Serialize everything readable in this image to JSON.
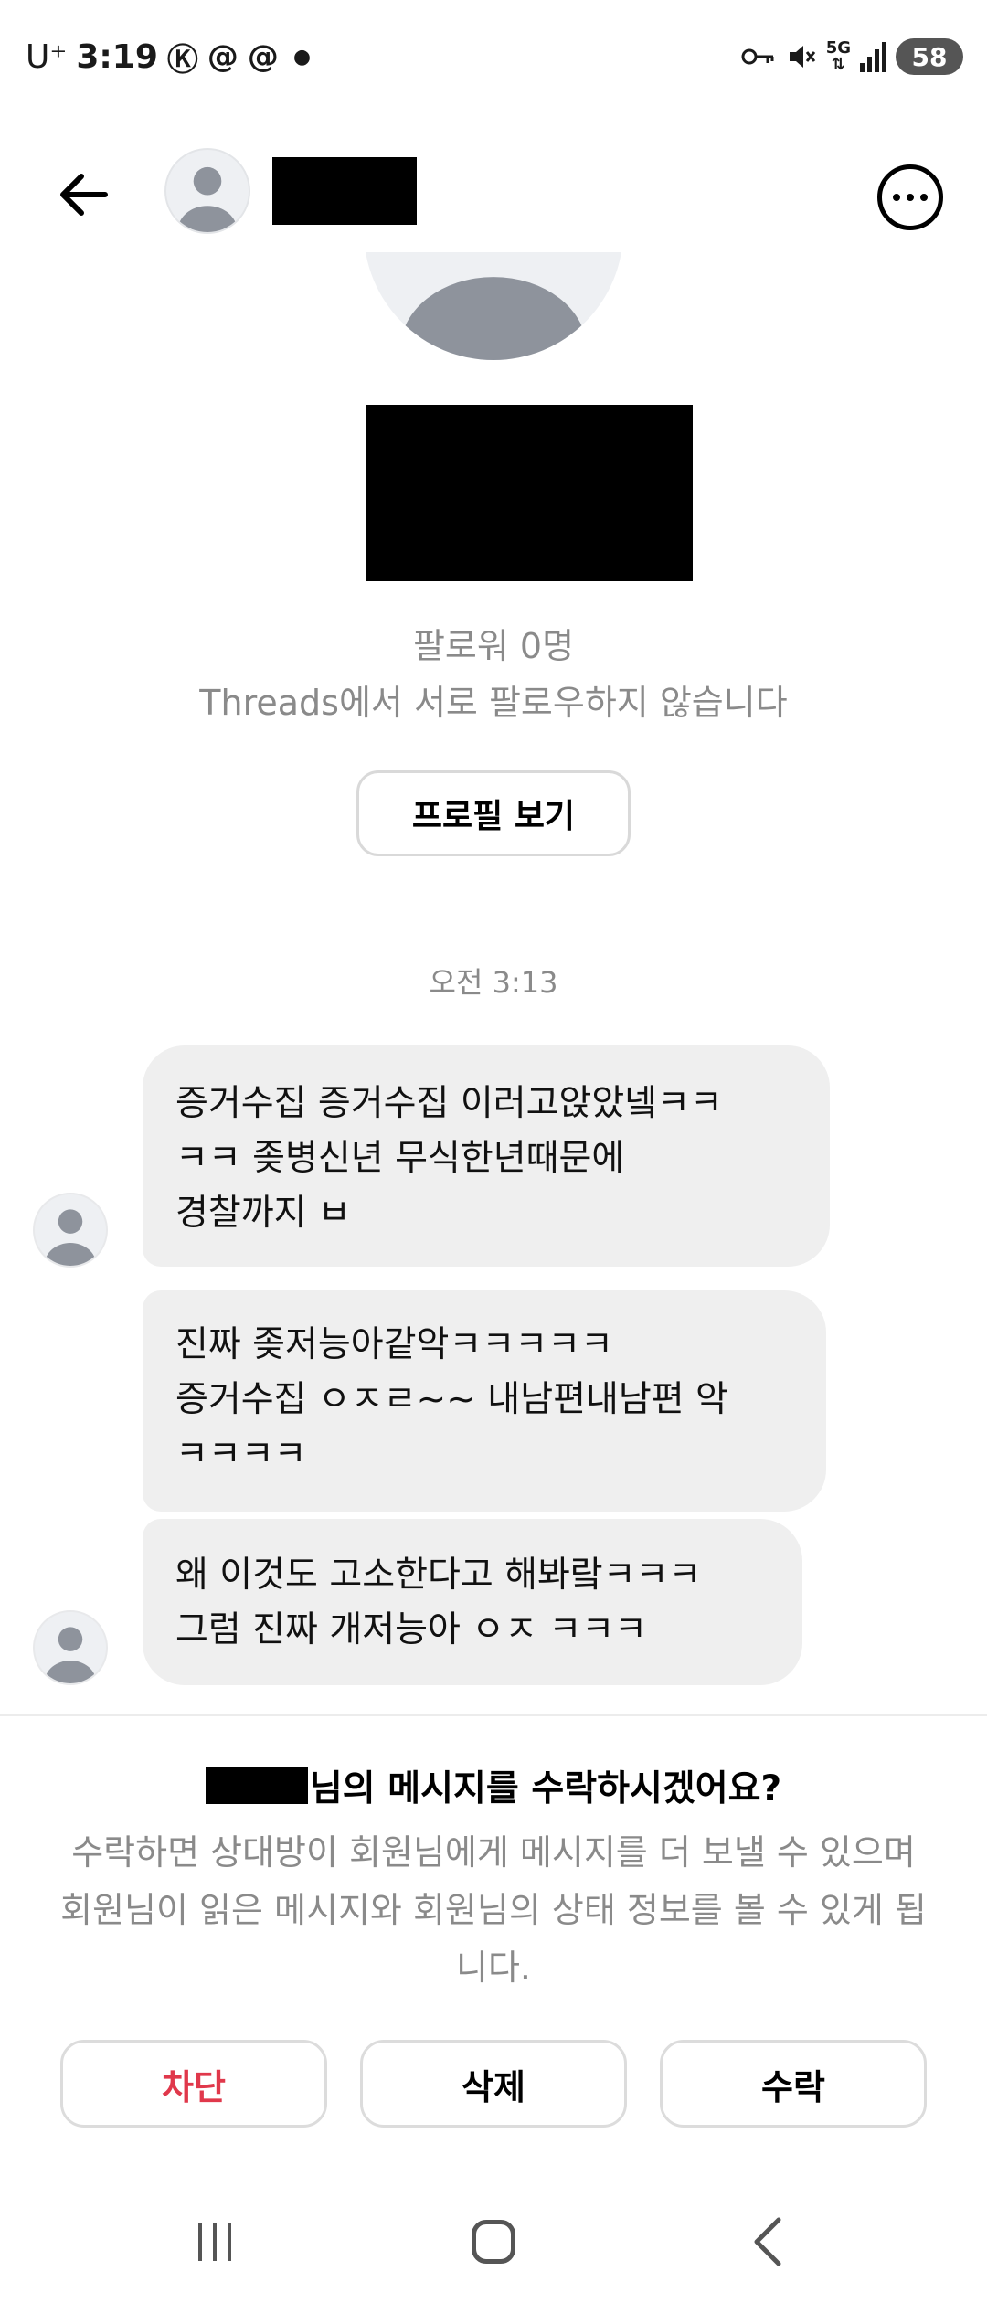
{
  "status_bar": {
    "carrier": "U⁺",
    "time": "3:19",
    "notification_glyphs": [
      "Ⓚ",
      "@",
      "@"
    ],
    "network": "5G",
    "battery": "58"
  },
  "header": {
    "name_partial": "..."
  },
  "profile": {
    "followers": "팔로워 0명",
    "mutual_status": "Threads에서 서로 팔로우하지 않습니다",
    "view_profile_label": "프로필 보기"
  },
  "messages": {
    "timestamp": "오전 3:13",
    "items": [
      {
        "lines": [
          "증거수집 증거수집 이러고앉았넼ㅋㅋ",
          "ㅋㅋ 좆병신년 무식한년때문에",
          "경찰까지 ㅂ"
        ]
      },
      {
        "lines": [
          "진짜 좆저능아같악ㅋㅋㅋㅋㅋ",
          "증거수집 ㅇㅈㄹ~~ 내남편내남편 악",
          "ㅋㅋㅋㅋ"
        ]
      },
      {
        "lines": [
          "왜 이것도 고소한다고 해봐랔ㅋㅋㅋ",
          "그럼 진짜 개저능아 ㅇㅈ ㅋㅋㅋ"
        ]
      }
    ]
  },
  "request": {
    "title_suffix": "님의 메시지를 수락하시겠어요?",
    "description": "수락하면 상대방이 회원님에게 메시지를 더 보낼 수 있으며 회원님이 읽은 메시지와 회원님의 상태 정보를 볼 수 있게 됩니다.",
    "block_label": "차단",
    "delete_label": "삭제",
    "accept_label": "수락"
  },
  "colors": {
    "block_text": "#e0384b",
    "bubble_bg": "#efefef",
    "secondary_text": "#8a8a8a"
  },
  "icons": [
    "back-arrow-icon",
    "more-options-icon",
    "default-avatar-icon",
    "recent-apps-icon",
    "home-icon",
    "nav-back-icon"
  ]
}
